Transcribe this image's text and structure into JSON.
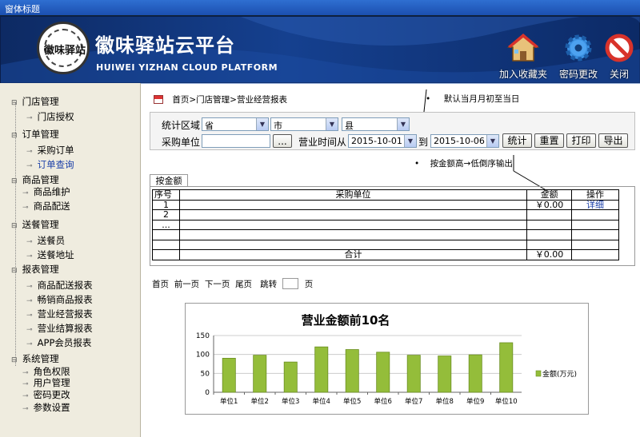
{
  "window": {
    "title": "窗体标题"
  },
  "brand": {
    "name_cn": "徽味驿站云平台",
    "name_en": "HUIWEI YIZHAN CLOUD PLATFORM",
    "logo_text": "徽味驿站"
  },
  "top_actions": [
    {
      "label": "加入收藏夹",
      "icon": "home-icon"
    },
    {
      "label": "密码更改",
      "icon": "gear-icon"
    },
    {
      "label": "关闭",
      "icon": "close-icon"
    }
  ],
  "sidebar": {
    "groups": [
      {
        "label": "门店管理",
        "items": [
          "门店授权"
        ]
      },
      {
        "label": "订单管理",
        "items": [
          "采购订单",
          "订单查询"
        ]
      },
      {
        "label": "商品管理",
        "items": [
          "商品维护",
          "商品配送"
        ]
      },
      {
        "label": "送餐管理",
        "items": [
          "送餐员",
          "送餐地址"
        ]
      },
      {
        "label": "报表管理",
        "items": [
          "商品配送报表",
          "畅销商品报表",
          "营业经营报表",
          "营业结算报表",
          "APP会员报表"
        ]
      },
      {
        "label": "系统管理",
        "items": [
          "角色权限",
          "用户管理",
          "密码更改",
          "参数设置"
        ]
      }
    ],
    "active_item": "订单查询",
    "colors": {
      "active": "#1b3fa8"
    }
  },
  "breadcrumb": "首页>门店管理>营业经营报表",
  "annotations": {
    "default_range": "默认当月月初至当日",
    "sort_note": "按金额高→低倒序输出"
  },
  "filters": {
    "region_label": "统计区域",
    "province": "省",
    "city": "市",
    "county": "县",
    "unit_label": "采购单位",
    "unit_value": "",
    "unit_picker": "...",
    "time_label": "营业时间从",
    "date_from": "2015-10-01",
    "to_label": "到",
    "date_to": "2015-10-06",
    "buttons": [
      "统计",
      "重置",
      "打印",
      "导出"
    ]
  },
  "tab": {
    "label": "按金额"
  },
  "table": {
    "headers": [
      "序号",
      "采购单位",
      "金额",
      "操作"
    ],
    "rows": [
      [
        "1",
        "",
        "￥0.00",
        "详细"
      ],
      [
        "2",
        "",
        "",
        ""
      ],
      [
        "...",
        "",
        "",
        ""
      ],
      [
        "",
        "",
        "",
        ""
      ],
      [
        "",
        "",
        "",
        ""
      ]
    ],
    "total_label": "合计",
    "total_value": "￥0.00"
  },
  "pager": {
    "first": "首页",
    "prev": "前一页",
    "next": "下一页",
    "last": "尾页",
    "jump": "跳转",
    "page_unit": "页"
  },
  "chart_data": {
    "type": "bar",
    "title": "营业金额前10名",
    "categories": [
      "单位1",
      "单位2",
      "单位3",
      "单位4",
      "单位5",
      "单位6",
      "单位7",
      "单位8",
      "单位9",
      "单位10"
    ],
    "series": [
      {
        "name": "金额(万元)",
        "values": [
          90,
          98,
          80,
          120,
          113,
          106,
          98,
          96,
          99,
          131
        ]
      }
    ],
    "ylim": [
      0,
      150
    ],
    "yticks": [
      "0",
      "50",
      "100",
      "150"
    ],
    "grid": true,
    "legend": "right",
    "bar_color": "#94bd3a"
  }
}
